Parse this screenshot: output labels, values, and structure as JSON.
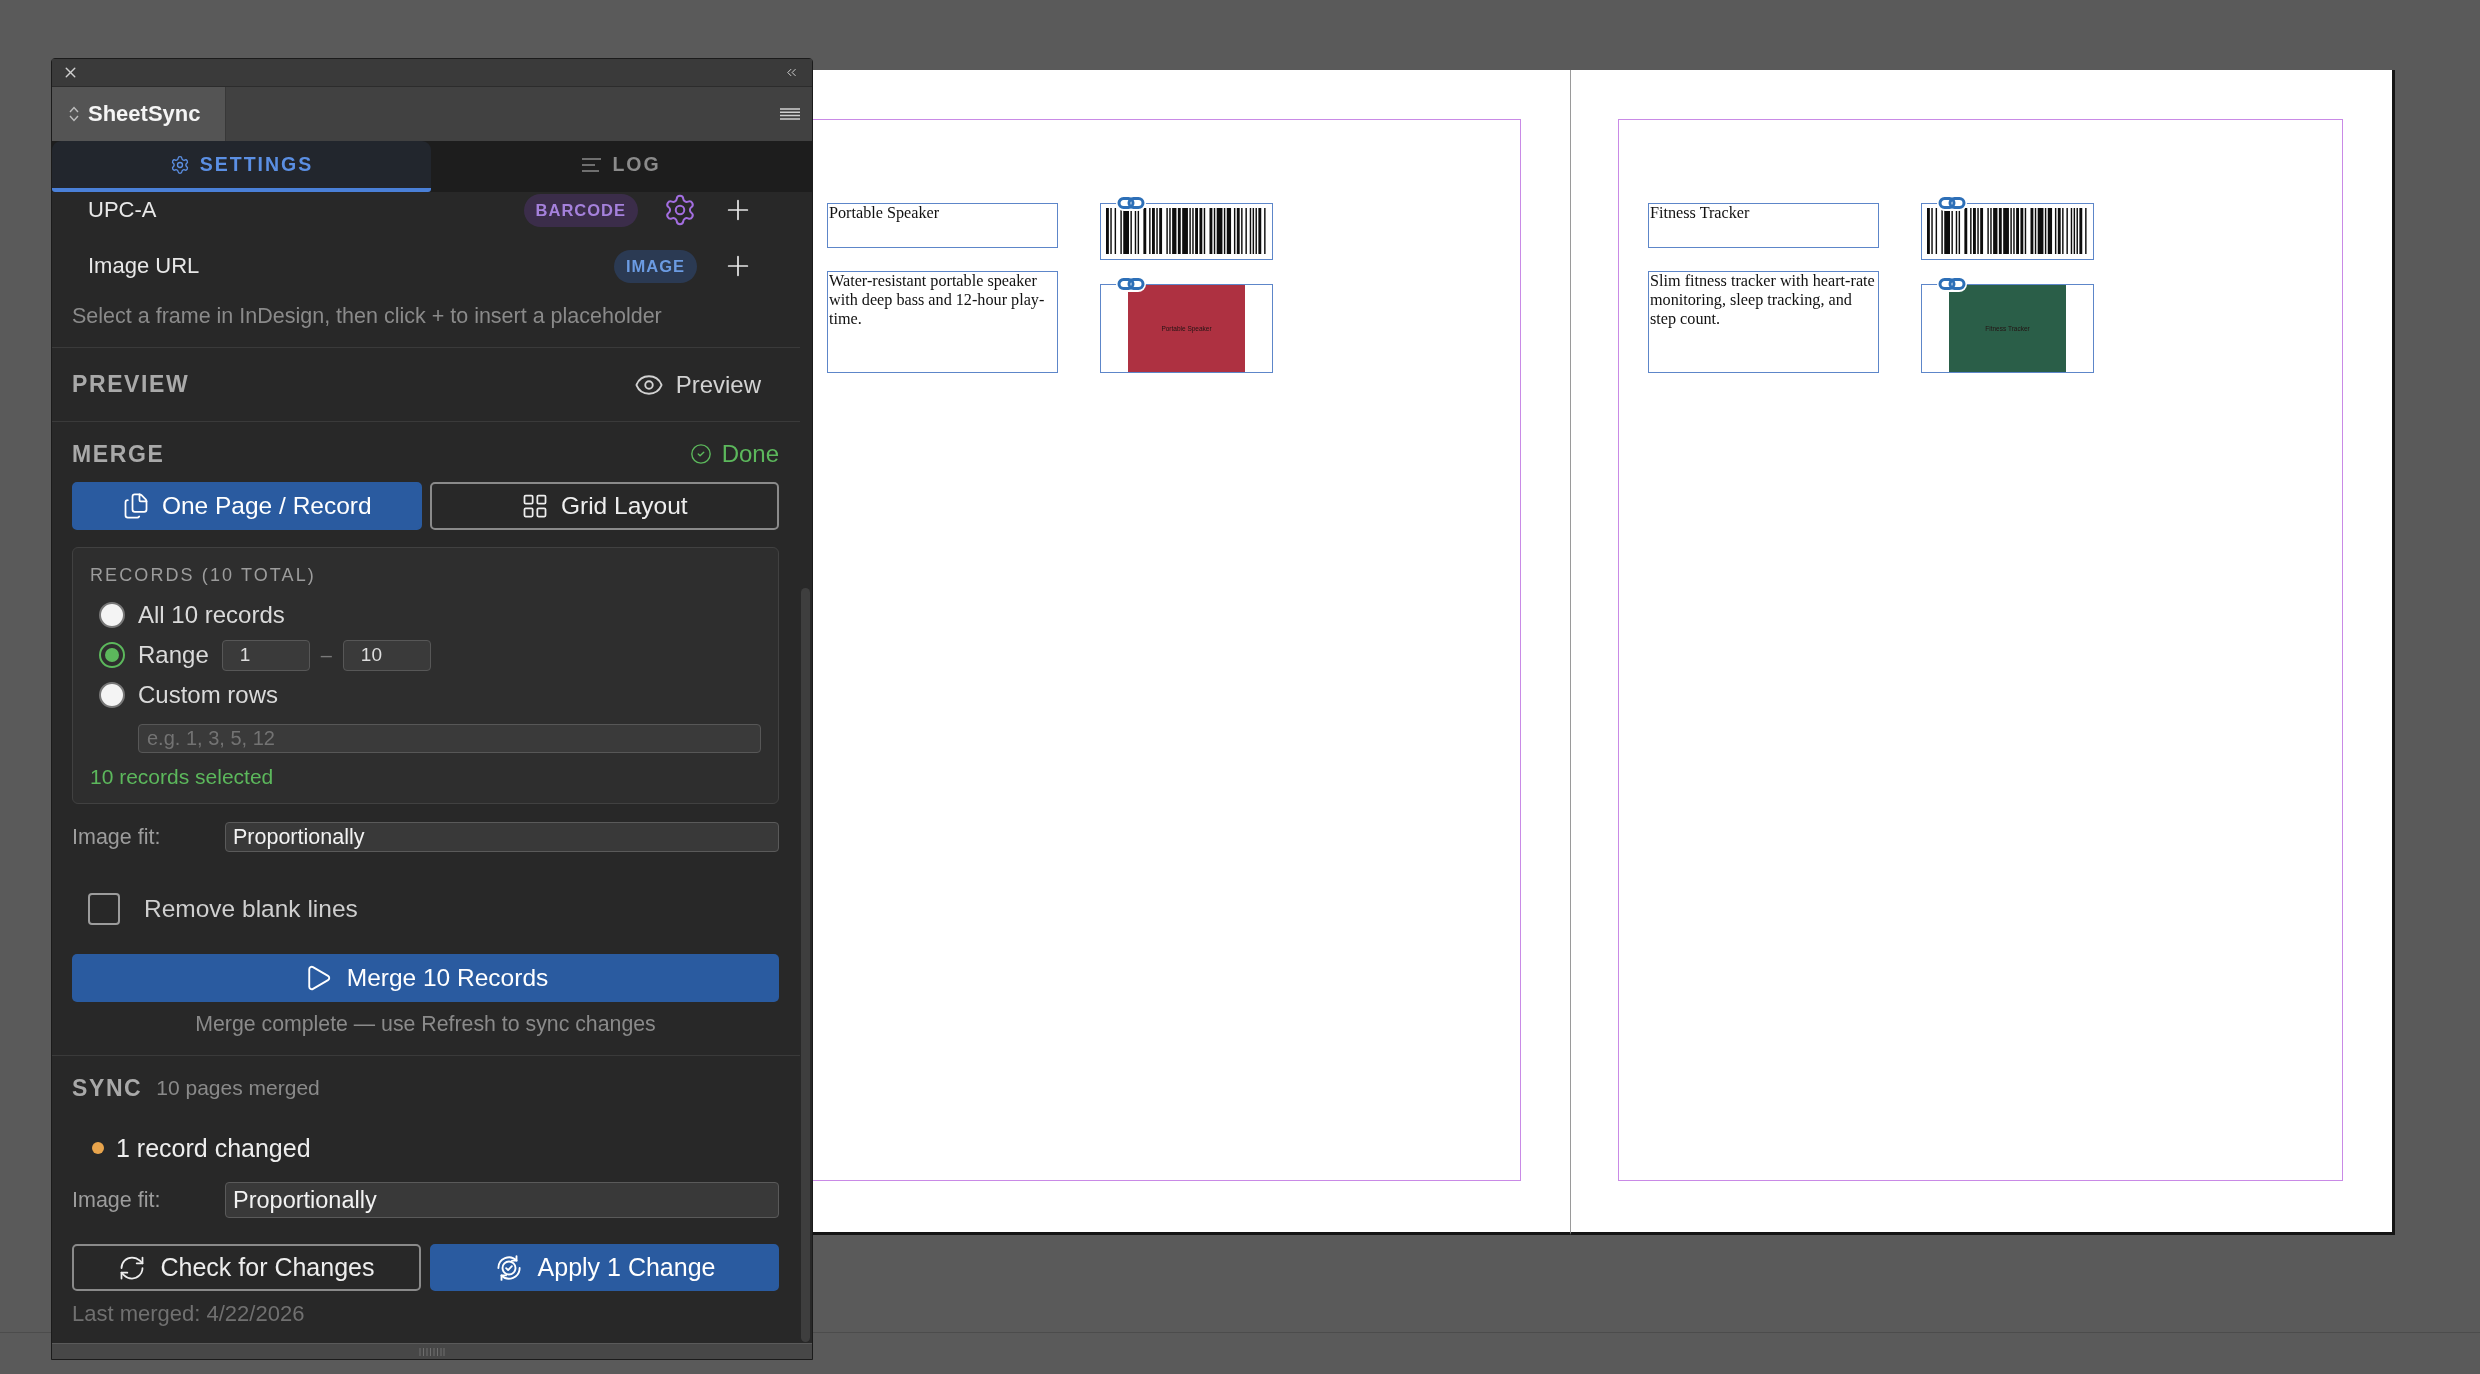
{
  "panel": {
    "title": "SheetSync",
    "tabs": [
      {
        "label": "SETTINGS",
        "kind": "settings",
        "selected": true
      },
      {
        "label": "LOG",
        "kind": "log",
        "selected": false
      }
    ],
    "fields": [
      {
        "name": "UPC-A",
        "badge": "BARCODE",
        "kind": "barcode"
      },
      {
        "name": "Image URL",
        "badge": "IMAGE",
        "kind": "image"
      }
    ],
    "field_hint": "Select a frame in InDesign, then click + to insert a placeholder",
    "preview": {
      "heading": "PREVIEW",
      "button": "Preview"
    },
    "merge": {
      "heading": "MERGE",
      "status": "Done",
      "modes": [
        {
          "label": "One Page / Record",
          "kind": "pages",
          "selected": true
        },
        {
          "label": "Grid Layout",
          "kind": "grid",
          "selected": false
        }
      ],
      "records": {
        "heading": "RECORDS (10 TOTAL)",
        "options": [
          {
            "label": "All 10 records",
            "kind": "all",
            "selected": false
          },
          {
            "label": "Range",
            "kind": "range",
            "selected": true,
            "from": "1",
            "separator": "–",
            "to": "10"
          },
          {
            "label": "Custom rows",
            "kind": "custom",
            "selected": false,
            "placeholder": "e.g. 1, 3, 5, 12"
          }
        ],
        "summary": "10 records selected"
      },
      "image_fit": {
        "label": "Image fit:",
        "value": "Proportionally"
      },
      "remove_blank_lines": {
        "label": "Remove blank lines",
        "checked": false
      },
      "button": "Merge 10 Records",
      "note": "Merge complete — use Refresh to sync changes"
    },
    "sync": {
      "heading": "SYNC",
      "subheading": "10 pages merged",
      "change": {
        "text": "1 record changed",
        "color": "#e8a44c"
      },
      "image_fit": {
        "label": "Image fit:",
        "value": "Proportionally"
      },
      "buttons": [
        {
          "label": "Check for Changes",
          "kind": "check"
        },
        {
          "label": "Apply 1 Change",
          "kind": "apply"
        }
      ],
      "last_merged": "Last merged: 4/22/2026"
    }
  },
  "document": {
    "pages": [
      {
        "title": "Portable Speaker",
        "description": "Water-resistant portable speaker with deep bass and 12-hour play-time.",
        "image": {
          "label": "Portable Speaker",
          "color": "#ae3141"
        }
      },
      {
        "title": "Fitness Tracker",
        "description": "Slim fitness tracker with heart-rate monitoring, sleep tracking, and step count.",
        "image": {
          "label": "Fitness Tracker",
          "color": "#2a5e48"
        }
      }
    ]
  }
}
